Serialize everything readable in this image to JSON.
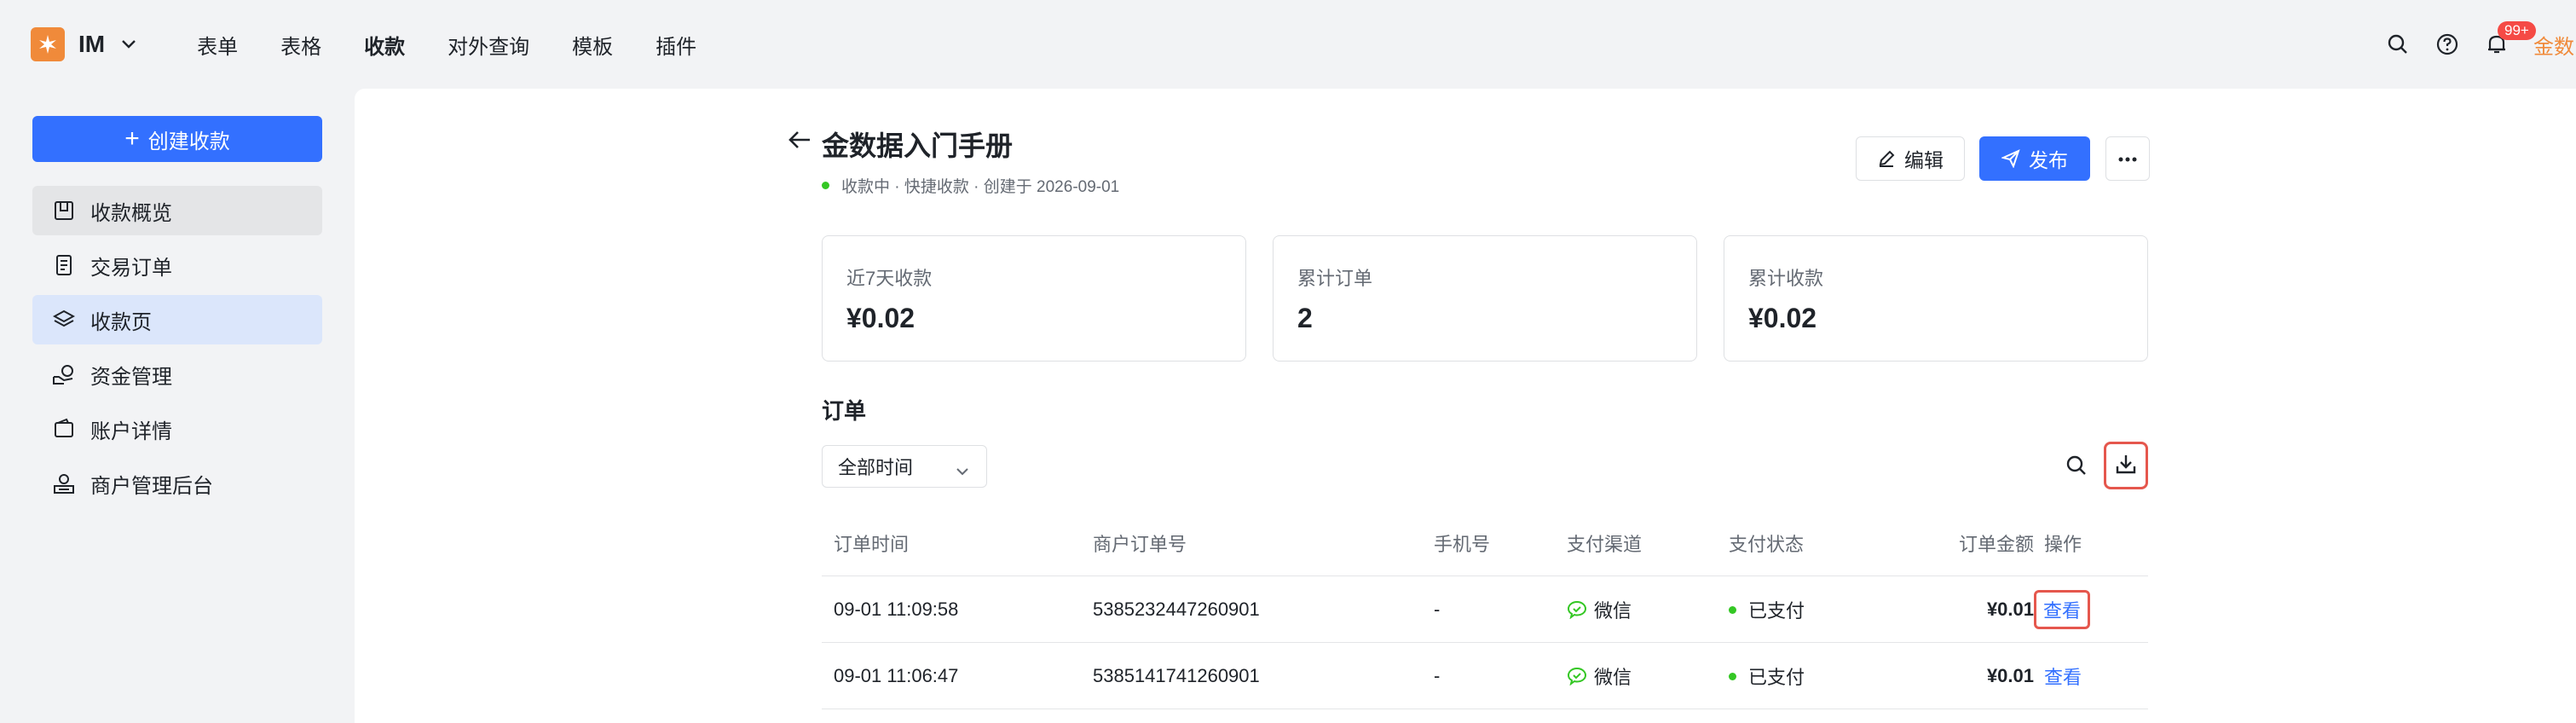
{
  "app": {
    "name": "IM",
    "nav": [
      "表单",
      "表格",
      "收款",
      "对外查询",
      "模板",
      "插件"
    ],
    "active_nav_index": 2,
    "notification_badge": "99+",
    "avatar_text": "金数"
  },
  "sidebar": {
    "create_label": "创建收款",
    "items": [
      {
        "label": "收款概览",
        "icon": "panel-icon"
      },
      {
        "label": "交易订单",
        "icon": "receipt-icon"
      },
      {
        "label": "收款页",
        "icon": "layers-icon"
      },
      {
        "label": "资金管理",
        "icon": "money-hand-icon"
      },
      {
        "label": "账户详情",
        "icon": "wallet-icon"
      },
      {
        "label": "商户管理后台",
        "icon": "merchant-icon"
      }
    ]
  },
  "page": {
    "title": "金数据入门手册",
    "subtitle": "收款中 · 快捷收款 · 创建于 2026-09-01",
    "edit_label": "编辑",
    "publish_label": "发布",
    "stats": [
      {
        "label": "近7天收款",
        "value": "¥0.02"
      },
      {
        "label": "累计订单",
        "value": "2"
      },
      {
        "label": "累计收款",
        "value": "¥0.02"
      }
    ],
    "orders_title": "订单",
    "time_filter": "全部时间"
  },
  "table": {
    "headers": {
      "time": "订单时间",
      "order_no": "商户订单号",
      "phone": "手机号",
      "channel": "支付渠道",
      "status": "支付状态",
      "amount": "订单金额",
      "op": "操作"
    },
    "rows": [
      {
        "time": "09-01 11:09:58",
        "order_no": "5385232447260901",
        "phone": "-",
        "channel": "微信",
        "status": "已支付",
        "amount": "¥0.01",
        "op": "查看"
      },
      {
        "time": "09-01 11:06:47",
        "order_no": "5385141741260901",
        "phone": "-",
        "channel": "微信",
        "status": "已支付",
        "amount": "¥0.01",
        "op": "查看"
      }
    ]
  },
  "colors": {
    "primary": "#3370ff",
    "brand": "#f08a3a",
    "highlight": "#e5574d",
    "success": "#34c724"
  }
}
